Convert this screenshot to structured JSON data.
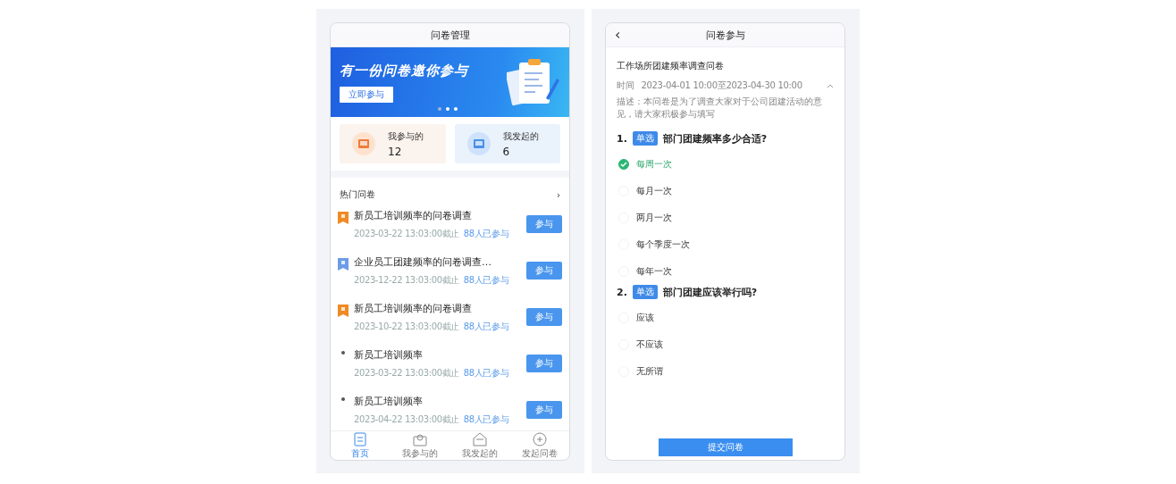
{
  "list_screen": {
    "title": "问卷管理",
    "banner": {
      "headline": "有一份问卷邀你参与",
      "button": "立即参与",
      "dots": [
        {
          "selected": true
        },
        {
          "selected": false
        },
        {
          "selected": false
        }
      ]
    },
    "stats": [
      {
        "kind": "joined",
        "label": "我参与的",
        "value": "12"
      },
      {
        "kind": "created",
        "label": "我发起的",
        "value": "6"
      }
    ],
    "section": {
      "title": "热门问卷",
      "more": "›"
    },
    "items": [
      {
        "kind": "flag",
        "color": "#f08a24",
        "title": "新员工培训频率的问卷调查",
        "deadline": "2023-03-22 13:03:00截止",
        "participants": "88人已参与",
        "button": "参与"
      },
      {
        "kind": "flag",
        "color": "#6d9be6",
        "title": "企业员工团建频率的问卷调查…",
        "deadline": "2023-12-22 13:03:00截止",
        "participants": "88人已参与",
        "button": "参与"
      },
      {
        "kind": "flag",
        "color": "#f08a24",
        "title": "新员工培训频率的问卷调查",
        "deadline": "2023-10-22 13:03:00截止",
        "participants": "88人已参与",
        "button": "参与"
      },
      {
        "kind": "dot",
        "title": "新员工培训频率",
        "deadline": "2023-03-22 13:03:00截止",
        "participants": "88人已参与",
        "button": "参与"
      },
      {
        "kind": "dot",
        "title": "新员工培训频率",
        "deadline": "2023-04-22 13:03:00截止",
        "participants": "88人已参与",
        "button": "参与"
      }
    ],
    "tabs": [
      {
        "label": "首页",
        "selected": true
      },
      {
        "label": "我参与的",
        "selected": false
      },
      {
        "label": "我发起的",
        "selected": false
      },
      {
        "label": "发起问卷",
        "selected": false
      }
    ]
  },
  "form_screen": {
    "back": "‹",
    "title": "问卷参与",
    "survey_title": "工作场所团建频率调查问卷",
    "time_label": "时间",
    "time": "2023-04-01 10:00至2023-04-30 10:00",
    "description": "描述：本问卷是为了调查大家对于公司团建活动的意见，请大家积极参与填写",
    "questions": [
      {
        "number": "1.",
        "type": "单选",
        "text": "部门团建频率多少合适?",
        "options": [
          {
            "label": "每周一次",
            "selected": true
          },
          {
            "label": "每月一次",
            "selected": false
          },
          {
            "label": "两月一次",
            "selected": false
          },
          {
            "label": "每个季度一次",
            "selected": false
          },
          {
            "label": "每年一次",
            "selected": false
          }
        ]
      },
      {
        "number": "2.",
        "type": "单选",
        "text": "部门团建应该举行吗?",
        "options": [
          {
            "label": "应该",
            "selected": false
          },
          {
            "label": "不应该",
            "selected": false
          },
          {
            "label": "无所谓",
            "selected": false
          }
        ]
      }
    ],
    "submit": "提交问卷"
  }
}
